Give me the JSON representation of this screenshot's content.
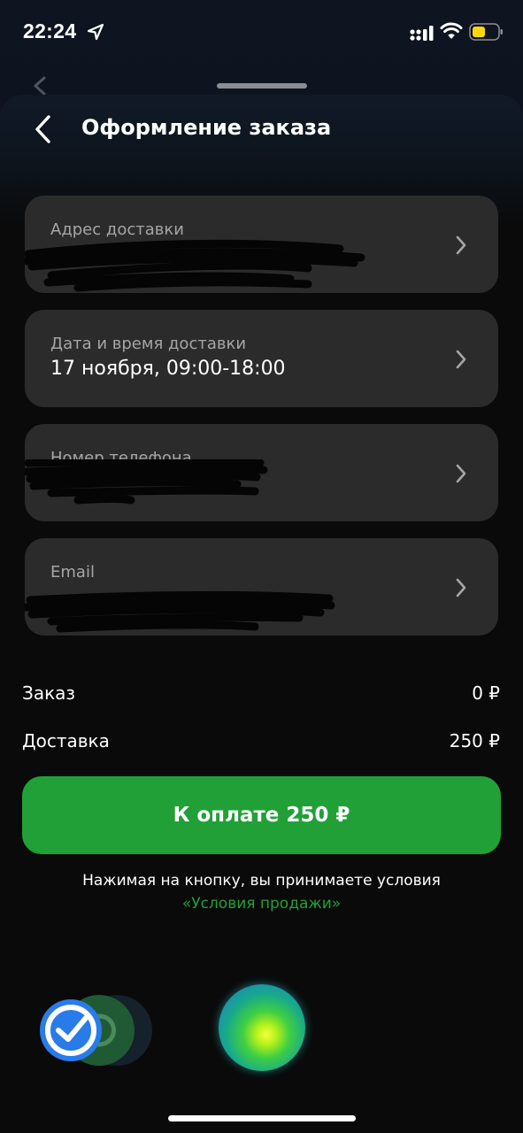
{
  "status_bar": {
    "time": "22:24",
    "icons": [
      "location-arrow-icon",
      "cellular-signal-icon",
      "wifi-icon",
      "battery-icon"
    ],
    "battery_level": 0.5,
    "battery_color": "#ffd60a"
  },
  "header": {
    "title": "Оформление заказа",
    "back_icon": "chevron-left-icon"
  },
  "fields": [
    {
      "label": "Адрес доставки",
      "value": "",
      "redacted": true
    },
    {
      "label": "Дата и время доставки",
      "value": "17 ноября, 09:00-18:00",
      "redacted": false
    },
    {
      "label": "Номер телефона",
      "value": "",
      "redacted": true
    },
    {
      "label": "Email",
      "value": "",
      "redacted": true
    }
  ],
  "summary": {
    "order_label": "Заказ",
    "order_value": "0 ₽",
    "delivery_label": "Доставка",
    "delivery_value": "250 ₽"
  },
  "pay_button": {
    "label": "К оплате  250 ₽"
  },
  "terms": {
    "text": "Нажимая на кнопку, вы принимаете условия",
    "link": "«Условия продажи»"
  },
  "bottom": {
    "icons": [
      "checkmark-app-icon",
      "sber-app-icon",
      "assistant-orb-icon"
    ]
  },
  "colors": {
    "accent_green": "#21a038",
    "card_bg": "#2b2b2b",
    "background": "#0a0a0a"
  }
}
